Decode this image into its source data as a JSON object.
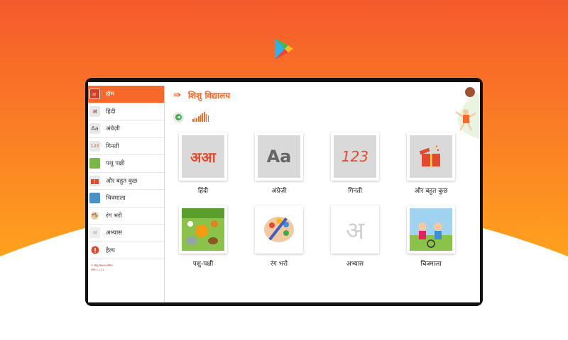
{
  "app": {
    "title": "शिशु विद्यालय",
    "menu_icon": "menu-arrow-icon"
  },
  "colors": {
    "accent": "#f7692a",
    "background_top": "#f55a2c",
    "background_bottom": "#ffa11e",
    "tile_gray": "#d9d9d9"
  },
  "sidebar": {
    "items": [
      {
        "label": "होम",
        "icon": "home-icon",
        "active": true
      },
      {
        "label": "हिंदी",
        "icon": "hindi-letters-icon"
      },
      {
        "label": "अंग्रेज़ी",
        "icon": "english-letters-icon"
      },
      {
        "label": "गिनती",
        "icon": "numbers-icon"
      },
      {
        "label": "पशु पक्षी",
        "icon": "animals-icon"
      },
      {
        "label": "और बहुत कुछ",
        "icon": "gift-icon"
      },
      {
        "label": "चित्रमाला",
        "icon": "picture-book-icon"
      },
      {
        "label": "रंग भरो",
        "icon": "paint-icon"
      },
      {
        "label": "अभ्यास",
        "icon": "practice-icon"
      },
      {
        "label": "हैल्प",
        "icon": "help-icon"
      }
    ],
    "footer_line1": "© शिशु विद्यालय वेबिना",
    "footer_line2": "वर्जन 1.1.12"
  },
  "tiles": [
    {
      "label": "हिंदी",
      "glyph": "अआ",
      "icon": "hindi-letters-icon"
    },
    {
      "label": "अंग्रेज़ी",
      "glyph": "Aa",
      "icon": "english-letters-icon"
    },
    {
      "label": "गिनती",
      "glyph": "123",
      "icon": "numbers-icon"
    },
    {
      "label": "और बहुत कुछ",
      "glyph": "",
      "icon": "gift-box-icon"
    },
    {
      "label": "पशु-पक्षी",
      "glyph": "",
      "icon": "animals-icon"
    },
    {
      "label": "रंग भरो",
      "glyph": "",
      "icon": "paint-palette-icon"
    },
    {
      "label": "अभ्यास",
      "glyph": "अ",
      "icon": "trace-letter-icon"
    },
    {
      "label": "चित्रमाला",
      "glyph": "",
      "icon": "kids-scene-icon"
    }
  ]
}
